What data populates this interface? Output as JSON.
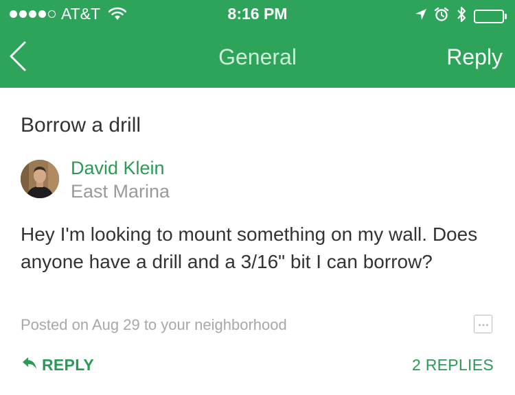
{
  "status_bar": {
    "carrier": "AT&T",
    "time": "8:16 PM",
    "signal_dots_filled": 4,
    "signal_dots_total": 5,
    "icons": [
      "wifi-icon",
      "location-arrow-icon",
      "alarm-icon",
      "bluetooth-icon",
      "battery-icon"
    ]
  },
  "nav": {
    "back_icon": "chevron-left-icon",
    "title": "General",
    "reply_label": "Reply"
  },
  "post": {
    "title": "Borrow a drill",
    "author": {
      "name": "David Klein",
      "location": "East Marina"
    },
    "body": "Hey I'm looking to mount something on my wall. Does anyone have a drill and a 3/16\" bit I can borrow?",
    "meta": "Posted on Aug 29 to your neighborhood",
    "more_icon": "more-options-icon"
  },
  "actions": {
    "reply_label": "REPLY",
    "reply_icon": "reply-arrow-icon",
    "replies_count": "2 REPLIES"
  },
  "colors": {
    "header_green": "#2ea35a",
    "accent_green": "#2a9a55",
    "muted_text": "#9a9a9a",
    "body_text": "#333333"
  }
}
